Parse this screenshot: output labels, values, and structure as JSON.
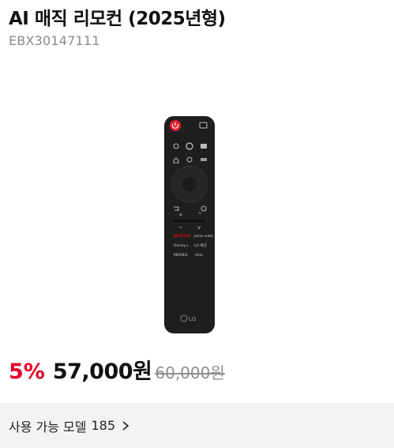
{
  "product": {
    "title": "AI 매직 리모컨 (2025년형)",
    "model_code": "EBX30147111",
    "image_icon": "remote-control-product-image",
    "brand_mark": "LG",
    "remote_buttons": {
      "netflix": "NETFLIX",
      "prime": "prime video",
      "disney": "Disney+",
      "lg_channels": "LG 채널",
      "movies": "MOVIES",
      "mini": "mini"
    }
  },
  "pricing": {
    "discount": "5%",
    "price": "57,000원",
    "original_price": "60,000원"
  },
  "compatible": {
    "label": "사용 가능 모델",
    "count": "185",
    "icon": "chevron-right-icon"
  },
  "colors": {
    "accent": "#e4002b",
    "remote_body": "#1e1e1e",
    "bar_bg": "#f3f3f3"
  }
}
